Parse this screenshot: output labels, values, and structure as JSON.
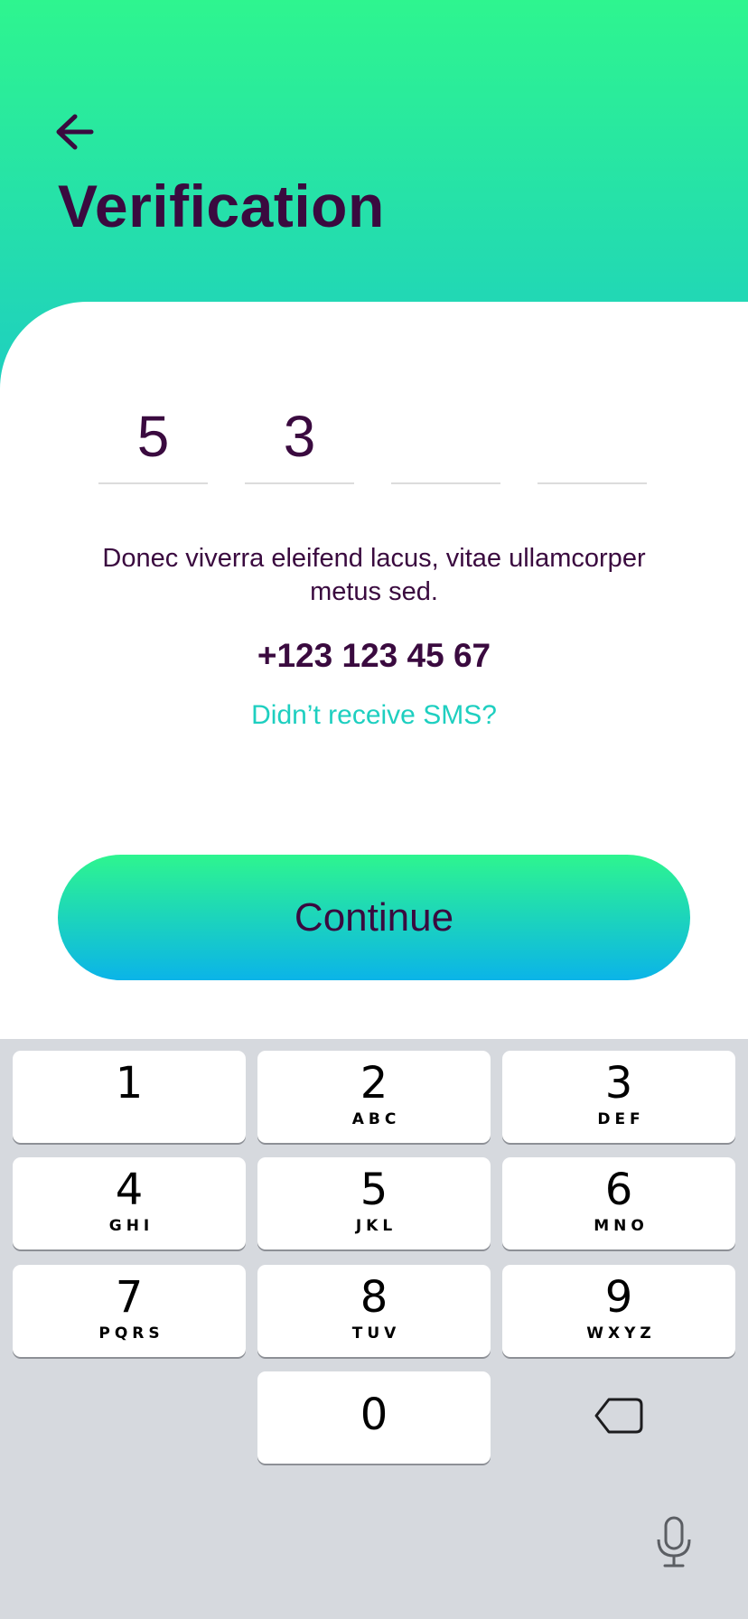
{
  "header": {
    "title": "Verification",
    "back_icon": "arrow-left-icon"
  },
  "code": {
    "digits": [
      "5",
      "3",
      "",
      ""
    ]
  },
  "message": {
    "description": "Donec viverra eleifend lacus, vitae ullamcorper metus sed.",
    "phone": "+123 123 45 67",
    "resend_link": "Didn’t receive SMS?"
  },
  "actions": {
    "continue_label": "Continue"
  },
  "keyboard": {
    "keys": [
      {
        "num": "1",
        "letters": ""
      },
      {
        "num": "2",
        "letters": "ABC"
      },
      {
        "num": "3",
        "letters": "DEF"
      },
      {
        "num": "4",
        "letters": "GHI"
      },
      {
        "num": "5",
        "letters": "JKL"
      },
      {
        "num": "6",
        "letters": "MNO"
      },
      {
        "num": "7",
        "letters": "PQRS"
      },
      {
        "num": "8",
        "letters": "TUV"
      },
      {
        "num": "9",
        "letters": "WXYZ"
      },
      {
        "num": "0",
        "letters": ""
      }
    ],
    "delete_icon": "backspace-icon",
    "mic_icon": "microphone-icon"
  },
  "colors": {
    "gradient_top": "#2ef58f",
    "gradient_bottom": "#1ecfc0",
    "button_bottom": "#0bb4e8",
    "text_dark": "#3a0a3f",
    "accent": "#1ecfc0",
    "keyboard_bg": "#d6d9de"
  }
}
